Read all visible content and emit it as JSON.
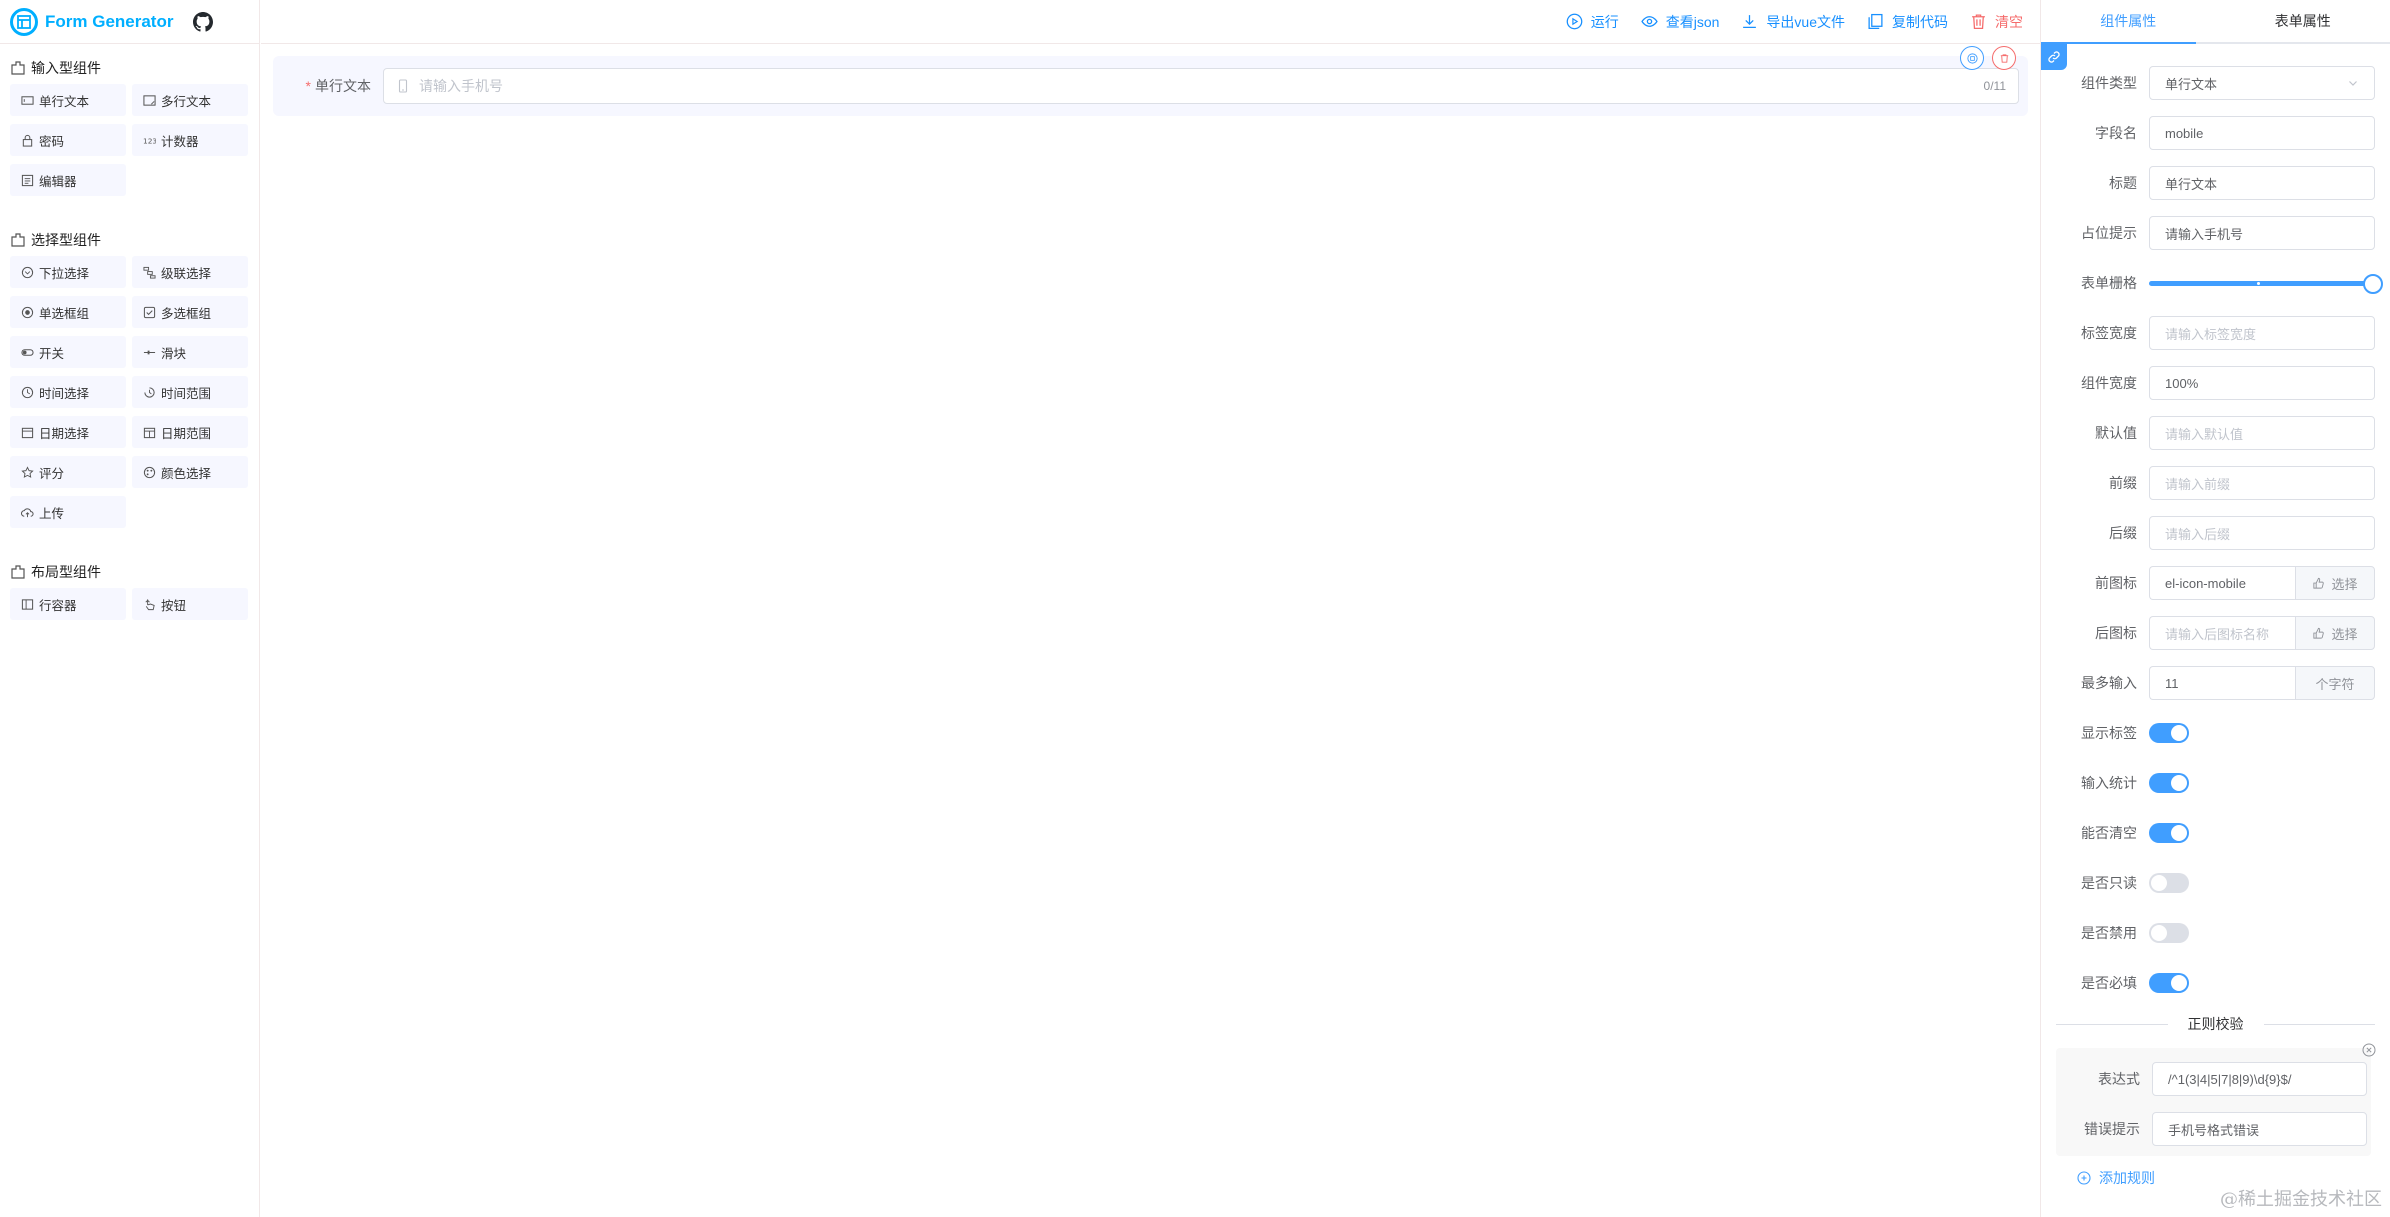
{
  "app": {
    "title": "Form Generator"
  },
  "palette": {
    "input_group": {
      "title": "输入型组件",
      "items": [
        {
          "label": "单行文本",
          "icon": "input-icon"
        },
        {
          "label": "多行文本",
          "icon": "textarea-icon"
        },
        {
          "label": "密码",
          "icon": "password-icon"
        },
        {
          "label": "计数器",
          "icon": "number-icon"
        },
        {
          "label": "编辑器",
          "icon": "editor-icon"
        }
      ]
    },
    "select_group": {
      "title": "选择型组件",
      "items": [
        {
          "label": "下拉选择",
          "icon": "select-icon"
        },
        {
          "label": "级联选择",
          "icon": "cascader-icon"
        },
        {
          "label": "单选框组",
          "icon": "radio-icon"
        },
        {
          "label": "多选框组",
          "icon": "checkbox-icon"
        },
        {
          "label": "开关",
          "icon": "switch-icon"
        },
        {
          "label": "滑块",
          "icon": "slider-icon"
        },
        {
          "label": "时间选择",
          "icon": "time-icon"
        },
        {
          "label": "时间范围",
          "icon": "time-range-icon"
        },
        {
          "label": "日期选择",
          "icon": "date-icon"
        },
        {
          "label": "日期范围",
          "icon": "date-range-icon"
        },
        {
          "label": "评分",
          "icon": "rate-icon"
        },
        {
          "label": "颜色选择",
          "icon": "color-icon"
        },
        {
          "label": "上传",
          "icon": "upload-icon"
        }
      ]
    },
    "layout_group": {
      "title": "布局型组件",
      "items": [
        {
          "label": "行容器",
          "icon": "row-icon"
        },
        {
          "label": "按钮",
          "icon": "button-icon"
        }
      ]
    }
  },
  "toolbar": {
    "run": "运行",
    "view_json": "查看json",
    "export_vue": "导出vue文件",
    "copy_code": "复制代码",
    "clear": "清空"
  },
  "canvas": {
    "field": {
      "required_mark": "*",
      "label": "单行文本",
      "placeholder": "请输入手机号",
      "count": "0/11"
    }
  },
  "panel": {
    "tabs": [
      "组件属性",
      "表单属性"
    ],
    "active_tab": 0,
    "props": {
      "type": {
        "label": "组件类型",
        "value": "单行文本"
      },
      "field_name": {
        "label": "字段名",
        "value": "mobile"
      },
      "title": {
        "label": "标题",
        "value": "单行文本"
      },
      "placeholder": {
        "label": "占位提示",
        "value": "请输入手机号"
      },
      "span": {
        "label": "表单栅格",
        "value": 24,
        "max": 24
      },
      "label_width": {
        "label": "标签宽度",
        "placeholder": "请输入标签宽度"
      },
      "width": {
        "label": "组件宽度",
        "value": "100%"
      },
      "default": {
        "label": "默认值",
        "placeholder": "请输入默认值"
      },
      "prefix": {
        "label": "前缀",
        "placeholder": "请输入前缀"
      },
      "suffix": {
        "label": "后缀",
        "placeholder": "请输入后缀"
      },
      "prefix_icon": {
        "label": "前图标",
        "value": "el-icon-mobile",
        "button": "选择"
      },
      "suffix_icon": {
        "label": "后图标",
        "placeholder": "请输入后图标名称",
        "button": "选择"
      },
      "maxlength": {
        "label": "最多输入",
        "value": "11",
        "unit": "个字符"
      },
      "show_label": {
        "label": "显示标签",
        "on": true
      },
      "show_word_limit": {
        "label": "输入统计",
        "on": true
      },
      "clearable": {
        "label": "能否清空",
        "on": true
      },
      "readonly": {
        "label": "是否只读",
        "on": false
      },
      "disabled": {
        "label": "是否禁用",
        "on": false
      },
      "required": {
        "label": "是否必填",
        "on": true
      }
    },
    "regex": {
      "title": "正则校验",
      "pattern_label": "表达式",
      "pattern": "/^1(3|4|5|7|8|9)\\d{9}$/",
      "message_label": "错误提示",
      "message": "手机号格式错误",
      "add": "添加规则"
    }
  },
  "watermark": "@稀土掘金技术社区",
  "colors": {
    "primary": "#409eff",
    "brand": "#00afff",
    "danger": "#f56c6c",
    "item_bg": "#f6f7ff"
  }
}
